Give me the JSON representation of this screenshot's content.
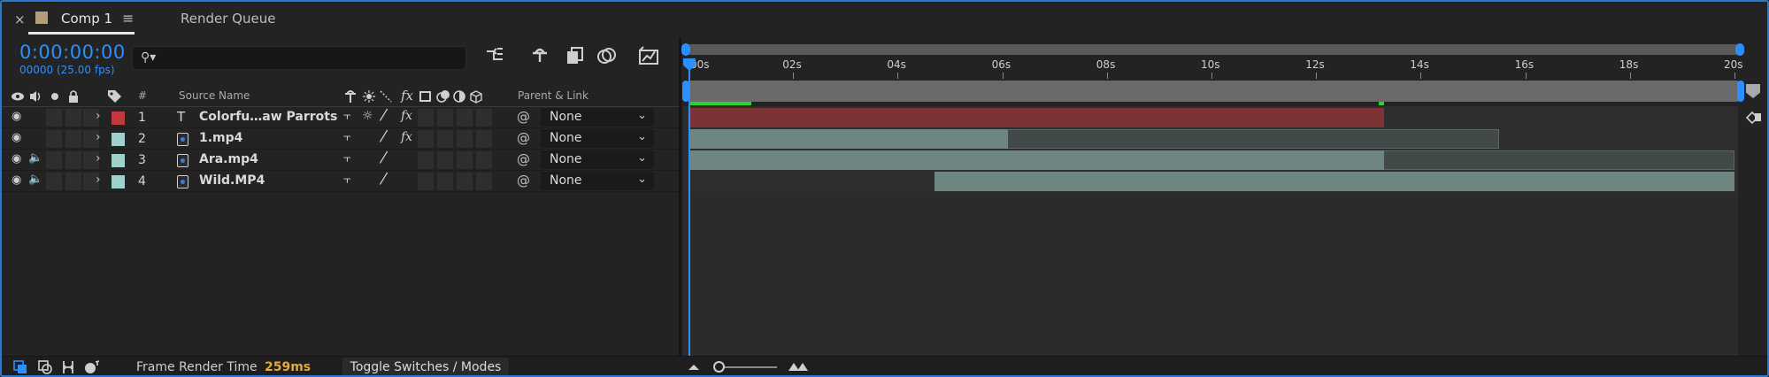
{
  "tabs": {
    "close_glyph": "×",
    "comp_title": "Comp 1",
    "menu_glyph": "≡",
    "render_queue": "Render Queue"
  },
  "header": {
    "timecode": "0:00:00:00",
    "frame_info": "00000 (25.00 fps)",
    "search_icon": "⚲▾"
  },
  "columns": {
    "hash": "#",
    "source_name": "Source Name",
    "parent_link": "Parent & Link",
    "fx": "fx"
  },
  "layers": [
    {
      "num": "1",
      "name": "Colorfu…aw Parrots",
      "type": "text",
      "label_color": "#c0393d",
      "audio": false,
      "fx": true,
      "parent": "None"
    },
    {
      "num": "2",
      "name": "1.mp4",
      "type": "footage",
      "label_color": "#9fd2cc",
      "audio": false,
      "fx": true,
      "parent": "None"
    },
    {
      "num": "3",
      "name": "Ara.mp4",
      "type": "footage",
      "label_color": "#9fd2cc",
      "audio": true,
      "fx": false,
      "parent": "None"
    },
    {
      "num": "4",
      "name": "Wild.MP4",
      "type": "footage",
      "label_color": "#9fd2cc",
      "audio": true,
      "fx": false,
      "parent": "None"
    }
  ],
  "text_layer_glyph": "T",
  "ruler": {
    "ticks": [
      "00s",
      "02s",
      "04s",
      "06s",
      "08s",
      "10s",
      "12s",
      "14s",
      "16s",
      "18s",
      "20s"
    ],
    "duration_s": 20
  },
  "tracks": [
    {
      "layer": "1",
      "in_s": 0,
      "out_s": 13.3,
      "active_out_s": 13.3,
      "color": "#7d3335"
    },
    {
      "layer": "2",
      "in_s": 0,
      "out_s": 15.5,
      "active_out_s": 6.1,
      "color": "#6f8582"
    },
    {
      "layer": "3",
      "in_s": 0,
      "out_s": 20,
      "active_out_s": 13.3,
      "color": "#6f8582"
    },
    {
      "layer": "4",
      "in_s": 4.7,
      "out_s": 20,
      "active_out_s": 20,
      "color": "#6f8582"
    }
  ],
  "cache": [
    {
      "from_s": 0,
      "to_s": 1.2
    },
    {
      "from_s": 13.2,
      "to_s": 13.3
    }
  ],
  "bottom": {
    "frame_render_label": "Frame Render Time",
    "frame_render_value": "259ms",
    "toggle_label": "Toggle Switches / Modes"
  },
  "colors": {
    "accent": "#2b8fff",
    "render_time": "#e2a93b"
  }
}
